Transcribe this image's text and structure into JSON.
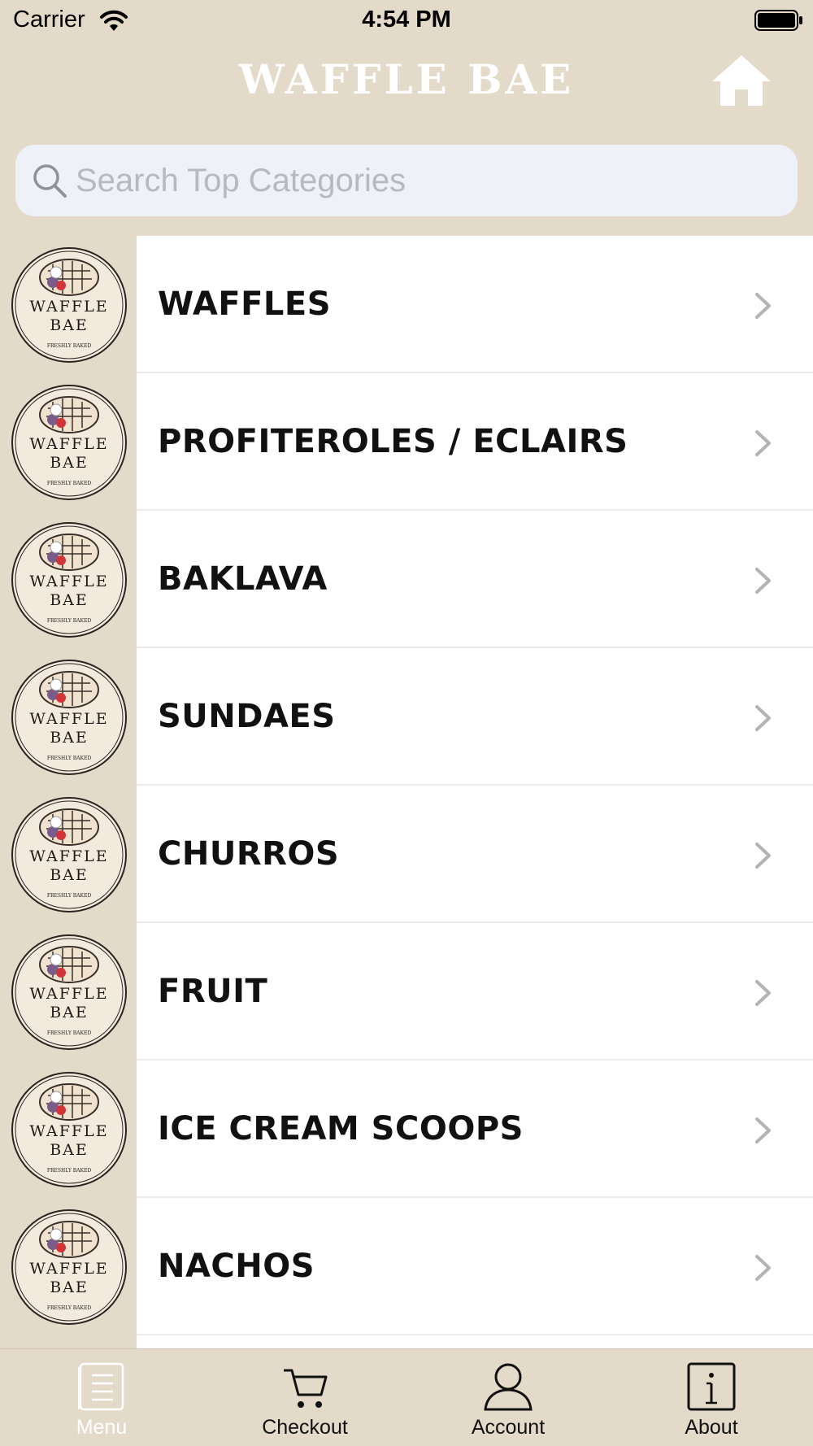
{
  "status_bar": {
    "carrier": "Carrier",
    "time": "4:54 PM"
  },
  "header": {
    "title": "WAFFLE BAE",
    "home_icon": "home-icon"
  },
  "search": {
    "placeholder": "Search Top Categories",
    "value": ""
  },
  "categories": [
    {
      "label": "WAFFLES"
    },
    {
      "label": "PROFITEROLES / ECLAIRS"
    },
    {
      "label": "BAKLAVA"
    },
    {
      "label": "SUNDAES"
    },
    {
      "label": "CHURROS"
    },
    {
      "label": "FRUIT"
    },
    {
      "label": "ICE CREAM SCOOPS"
    },
    {
      "label": "NACHOS"
    }
  ],
  "logo": {
    "line1": "WAFFLE",
    "line2": "BAE",
    "tagline": "FRESHLY BAKED"
  },
  "tabs": [
    {
      "label": "Menu",
      "icon": "menu-icon",
      "active": true
    },
    {
      "label": "Checkout",
      "icon": "cart-icon",
      "active": false
    },
    {
      "label": "Account",
      "icon": "person-icon",
      "active": false
    },
    {
      "label": "About",
      "icon": "info-icon",
      "active": false
    }
  ],
  "colors": {
    "beige": "#e4dac9",
    "search_bg": "#eef2f8",
    "text": "#111111",
    "active_tab": "#ffffff"
  }
}
